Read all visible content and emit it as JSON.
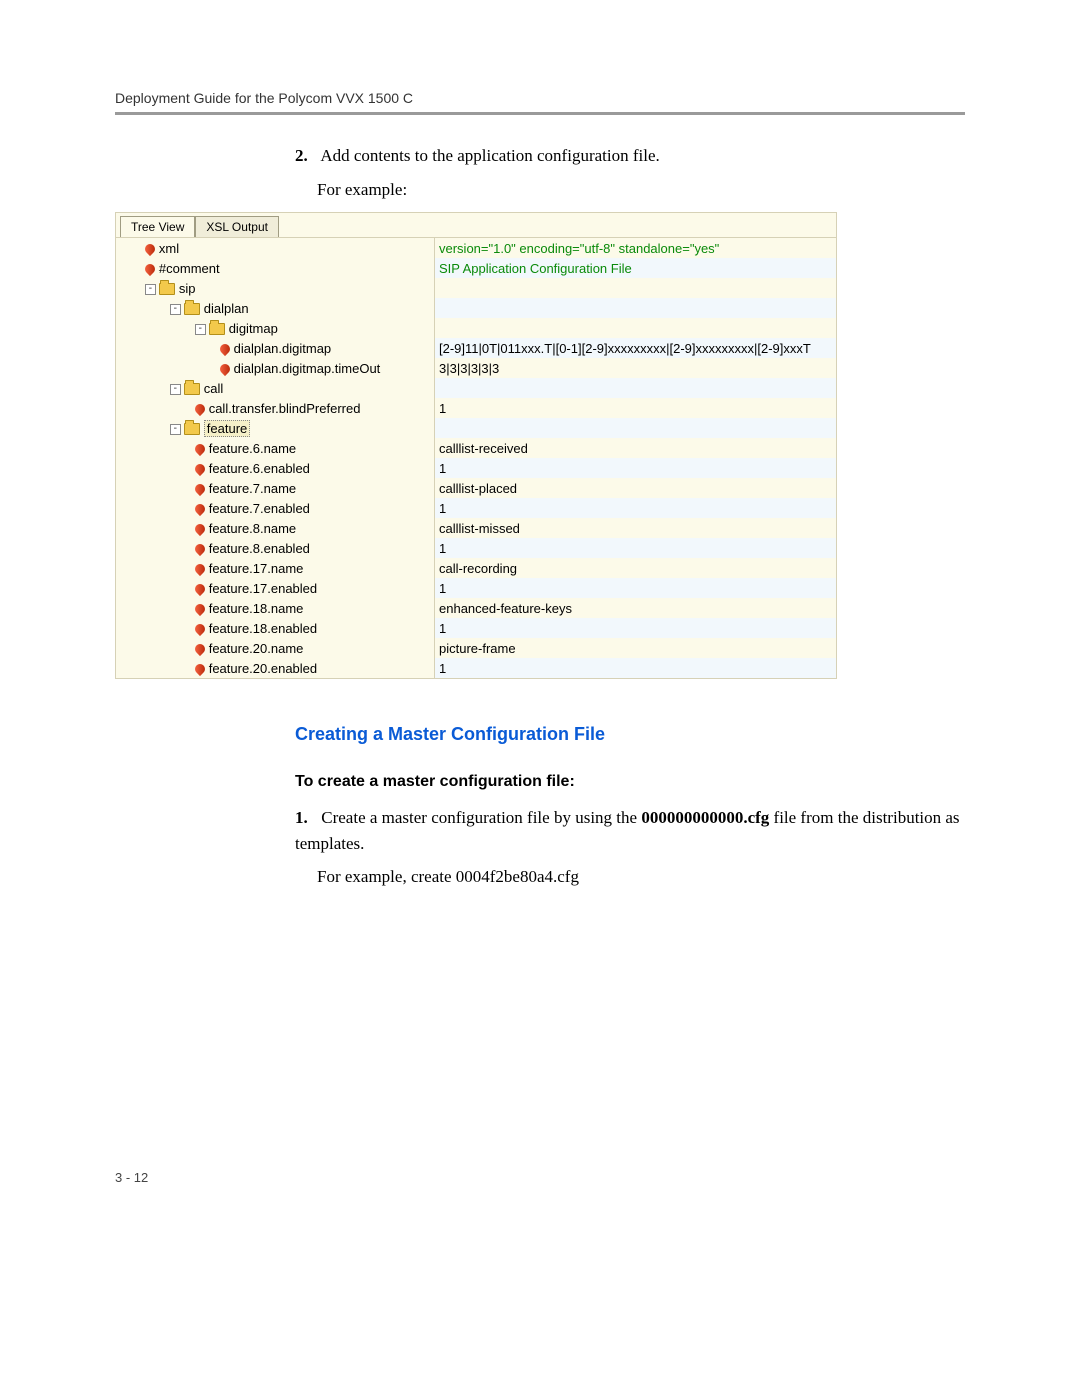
{
  "header": "Deployment Guide for the Polycom VVX 1500 C",
  "step2": {
    "num": "2.",
    "text": "Add contents to the application configuration file.",
    "example_label": "For example:"
  },
  "treeview": {
    "tabs": {
      "tree": "Tree View",
      "xsl": "XSL Output"
    },
    "rows": [
      {
        "indent": 1,
        "type": "leaf",
        "key": "xml",
        "val": "version=\"1.0\" encoding=\"utf-8\" standalone=\"yes\"",
        "valGreen": true
      },
      {
        "indent": 1,
        "type": "leaf",
        "key": "#comment",
        "val": "SIP Application Configuration File",
        "valGreen": true
      },
      {
        "indent": 1,
        "type": "folder",
        "exp": "-",
        "key": "sip",
        "val": ""
      },
      {
        "indent": 2,
        "type": "folder",
        "exp": "-",
        "key": "dialplan",
        "val": ""
      },
      {
        "indent": 3,
        "type": "folder",
        "exp": "-",
        "key": "digitmap",
        "val": ""
      },
      {
        "indent": 4,
        "type": "leaf",
        "key": "dialplan.digitmap",
        "val": "[2-9]11|0T|011xxx.T|[0-1][2-9]xxxxxxxxx|[2-9]xxxxxxxxx|[2-9]xxxT"
      },
      {
        "indent": 4,
        "type": "leaf",
        "key": "dialplan.digitmap.timeOut",
        "val": "3|3|3|3|3|3"
      },
      {
        "indent": 2,
        "type": "folder",
        "exp": "-",
        "key": "call",
        "val": ""
      },
      {
        "indent": 3,
        "type": "leaf",
        "key": "call.transfer.blindPreferred",
        "val": "1"
      },
      {
        "indent": 2,
        "type": "folder",
        "exp": "-",
        "key": "feature",
        "val": "",
        "selected": true
      },
      {
        "indent": 3,
        "type": "leaf",
        "key": "feature.6.name",
        "val": "calllist-received"
      },
      {
        "indent": 3,
        "type": "leaf",
        "key": "feature.6.enabled",
        "val": "1"
      },
      {
        "indent": 3,
        "type": "leaf",
        "key": "feature.7.name",
        "val": "calllist-placed"
      },
      {
        "indent": 3,
        "type": "leaf",
        "key": "feature.7.enabled",
        "val": "1"
      },
      {
        "indent": 3,
        "type": "leaf",
        "key": "feature.8.name",
        "val": "calllist-missed"
      },
      {
        "indent": 3,
        "type": "leaf",
        "key": "feature.8.enabled",
        "val": "1"
      },
      {
        "indent": 3,
        "type": "leaf",
        "key": "feature.17.name",
        "val": "call-recording"
      },
      {
        "indent": 3,
        "type": "leaf",
        "key": "feature.17.enabled",
        "val": "1"
      },
      {
        "indent": 3,
        "type": "leaf",
        "key": "feature.18.name",
        "val": "enhanced-feature-keys"
      },
      {
        "indent": 3,
        "type": "leaf",
        "key": "feature.18.enabled",
        "val": "1"
      },
      {
        "indent": 3,
        "type": "leaf",
        "key": "feature.20.name",
        "val": "picture-frame"
      },
      {
        "indent": 3,
        "type": "leaf",
        "key": "feature.20.enabled",
        "val": "1"
      }
    ]
  },
  "section_heading": "Creating a Master Configuration File",
  "sub_heading": "To create a master configuration file:",
  "step1b": {
    "num": "1.",
    "text_a": "Create a master configuration file by using the ",
    "filename": "000000000000.cfg",
    "text_b": " file from the distribution as templates.",
    "example": "For example, create 0004f2be80a4.cfg"
  },
  "page_num": "3 - 12"
}
